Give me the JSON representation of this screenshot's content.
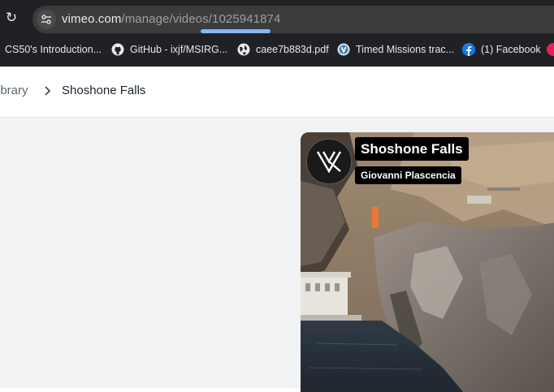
{
  "browser": {
    "url_host": "vimeo.com",
    "url_path_dim": "/manage/videos/",
    "url_id": "1025941874",
    "bookmarks": [
      {
        "label": "CS50's Introduction...",
        "icon": "none"
      },
      {
        "label": "GitHub - ixjf/MSIRG...",
        "icon": "github-icon"
      },
      {
        "label": "caee7b883d.pdf",
        "icon": "globe-icon"
      },
      {
        "label": "Timed Missions trac...",
        "icon": "v-logo-icon"
      },
      {
        "label": "(1) Facebook",
        "icon": "facebook-icon"
      }
    ]
  },
  "breadcrumb": {
    "parent": "ibrary",
    "current": "Shoshone Falls"
  },
  "video": {
    "title": "Shoshone Falls",
    "author": "Giovanni Plascencia"
  },
  "colors": {
    "chrome_bg": "#202124",
    "omnibox_bg": "#3c3c3c",
    "url_highlight": "#8ab4f8",
    "content_bg": "#f0f2f4",
    "facebook_blue": "#1877f2"
  }
}
